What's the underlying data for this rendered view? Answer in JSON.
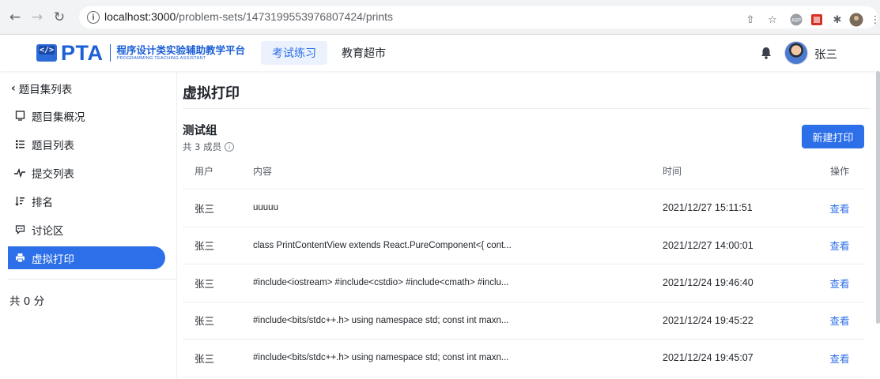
{
  "browser": {
    "url_host": "localhost:3000",
    "url_path": "/problem-sets/1473199553976807424/prints"
  },
  "header": {
    "logo_brand": "PTA",
    "logo_cn": "程序设计类实验辅助教学平台",
    "logo_en": "PROGRAMMING TEACHING ASSISTANT",
    "tabs": [
      {
        "label": "考试练习",
        "active": true
      },
      {
        "label": "教育超市",
        "active": false
      }
    ],
    "user_name": "张三"
  },
  "sidebar": {
    "back_label": "题目集列表",
    "items": [
      {
        "label": "题目集概况",
        "icon": "overview-icon"
      },
      {
        "label": "题目列表",
        "icon": "list-icon"
      },
      {
        "label": "提交列表",
        "icon": "pulse-icon"
      },
      {
        "label": "排名",
        "icon": "ranking-icon"
      },
      {
        "label": "讨论区",
        "icon": "chat-icon"
      },
      {
        "label": "虚拟打印",
        "icon": "printer-icon",
        "active": true
      }
    ],
    "score": "共 0 分"
  },
  "main": {
    "title": "虚拟打印",
    "group_name": "测试组",
    "group_count": "共 3 成员",
    "new_button": "新建打印",
    "columns": {
      "user": "用户",
      "content": "内容",
      "time": "时间",
      "action": "操作"
    },
    "rows": [
      {
        "user": "张三",
        "content": "uuuuu",
        "time": "2021/12/27 15:11:51",
        "action": "查看"
      },
      {
        "user": "张三",
        "content": "class PrintContentView extends React.PureComponent<{ cont...",
        "time": "2021/12/27 14:00:01",
        "action": "查看"
      },
      {
        "user": "张三",
        "content": "#include<iostream> #include<cstdio> #include<cmath> #inclu...",
        "time": "2021/12/24 19:46:40",
        "action": "查看"
      },
      {
        "user": "张三",
        "content": "#include<bits/stdc++.h> using namespace std; const int maxn...",
        "time": "2021/12/24 19:45:22",
        "action": "查看"
      },
      {
        "user": "张三",
        "content": "#include<bits/stdc++.h> using namespace std; const int maxn...",
        "time": "2021/12/24 19:45:07",
        "action": "查看"
      }
    ]
  },
  "colors": {
    "accent": "#2c6fe8",
    "brand": "#1d5fd6"
  }
}
